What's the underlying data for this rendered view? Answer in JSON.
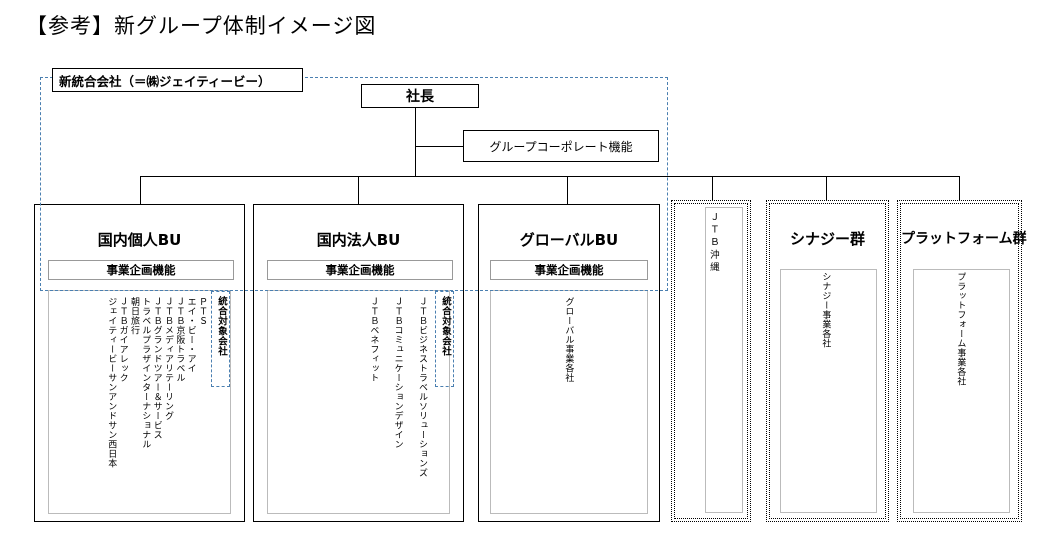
{
  "title": "【参考】新グループ体制イメージ図",
  "company_label": "新統合会社（＝㈱ジェイティービー）",
  "president": "社長",
  "corporate_function": "グループコーポレート機能",
  "plan_function": "事業企画機能",
  "integrated_tag": "統合対象会社",
  "columns": {
    "domestic_individual": {
      "name": "国内個人BU",
      "companies": [
        "ＰＴＳ",
        "エイ・ビー・アイ",
        "ＪＴＢ京阪トラベル",
        "ＪＴＢメディアリテーリング",
        "ＪＴＢグランドツアー＆サービス",
        "トラベルプラザインターナショナル",
        "朝日旅行",
        "ＪＴＢガイアレック",
        "ジェイティービーサンアンドサン西日本"
      ]
    },
    "domestic_corporate": {
      "name": "国内法人BU",
      "companies": [
        "ＪＴＢビジネストラベルソリューションズ",
        "ＪＴＢコミュニケーションデザイン",
        "ＪＴＢベネフィット"
      ]
    },
    "global": {
      "name": "グローバルBU",
      "companies": [
        "グローバル事業各社"
      ]
    },
    "okinawa": {
      "name": "ＪＴＢ沖縄"
    },
    "synergy": {
      "name": "シナジー群",
      "companies": [
        "シナジー事業各社"
      ]
    },
    "platform": {
      "name": "プラットフォーム群",
      "companies": [
        "プラットフォーム事業各社"
      ]
    }
  },
  "colors": {
    "dashed_frame": "#4a7fb0",
    "line": "#000000"
  }
}
